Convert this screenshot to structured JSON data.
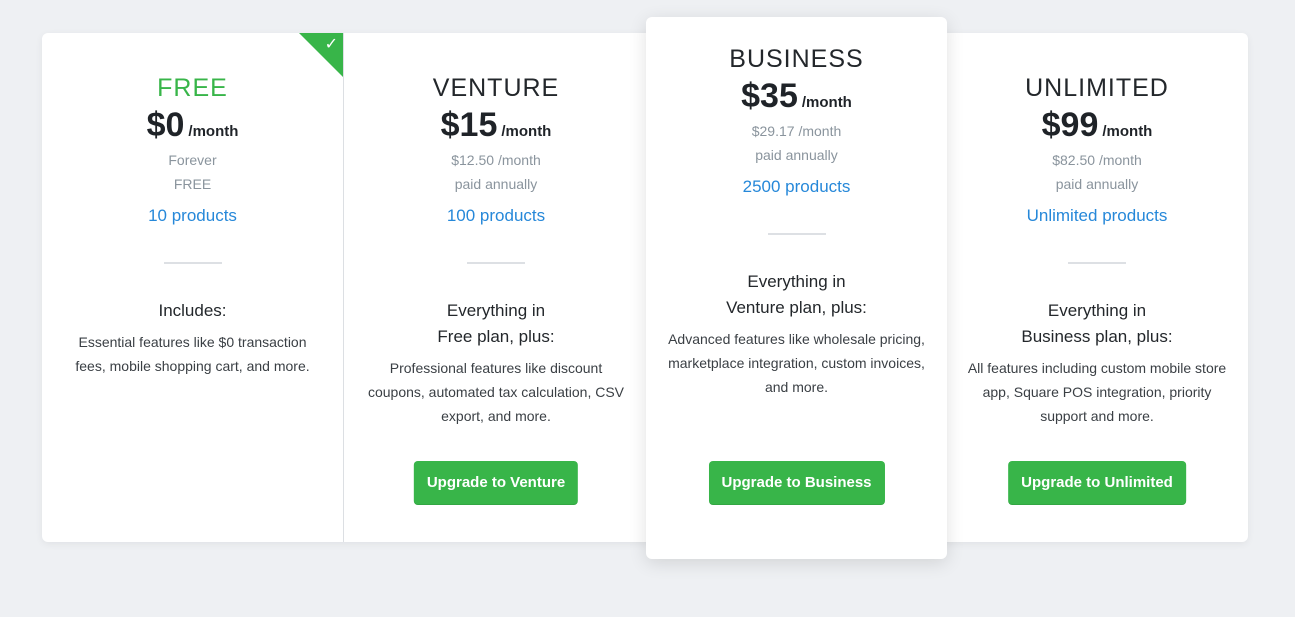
{
  "colors": {
    "accent_green": "#38b549",
    "link_blue": "#2688d9",
    "muted": "#8a949d",
    "background": "#eef0f3"
  },
  "plans": {
    "free": {
      "name": "FREE",
      "price": "$0",
      "per": "/month",
      "sub_line1": "Forever",
      "sub_line2": "FREE",
      "products": "10 products",
      "includes_line1": "Includes:",
      "features": "Essential features like $0 transaction fees, mobile shopping cart, and more.",
      "badge_icon": "check-icon"
    },
    "venture": {
      "name": "VENTURE",
      "price": "$15",
      "per": "/month",
      "sub_line1": "$12.50 /month",
      "sub_line2": "paid annually",
      "products": "100 products",
      "includes_line1": "Everything in",
      "includes_line2": "Free plan, plus:",
      "features": "Professional features like discount coupons, automated tax calculation, CSV export, and more.",
      "button": "Upgrade to Venture"
    },
    "business": {
      "name": "BUSINESS",
      "price": "$35",
      "per": "/month",
      "sub_line1": "$29.17 /month",
      "sub_line2": "paid annually",
      "products": "2500 products",
      "includes_line1": "Everything in",
      "includes_line2": "Venture plan, plus:",
      "features": "Advanced features like wholesale pricing, marketplace integration, custom invoices, and more.",
      "button": "Upgrade to Business"
    },
    "unlimited": {
      "name": "UNLIMITED",
      "price": "$99",
      "per": "/month",
      "sub_line1": "$82.50 /month",
      "sub_line2": "paid annually",
      "products": "Unlimited products",
      "includes_line1": "Everything in",
      "includes_line2": "Business plan, plus:",
      "features": "All features including custom mobile store app, Square POS integration, priority support and more.",
      "button": "Upgrade to Unlimited"
    }
  }
}
